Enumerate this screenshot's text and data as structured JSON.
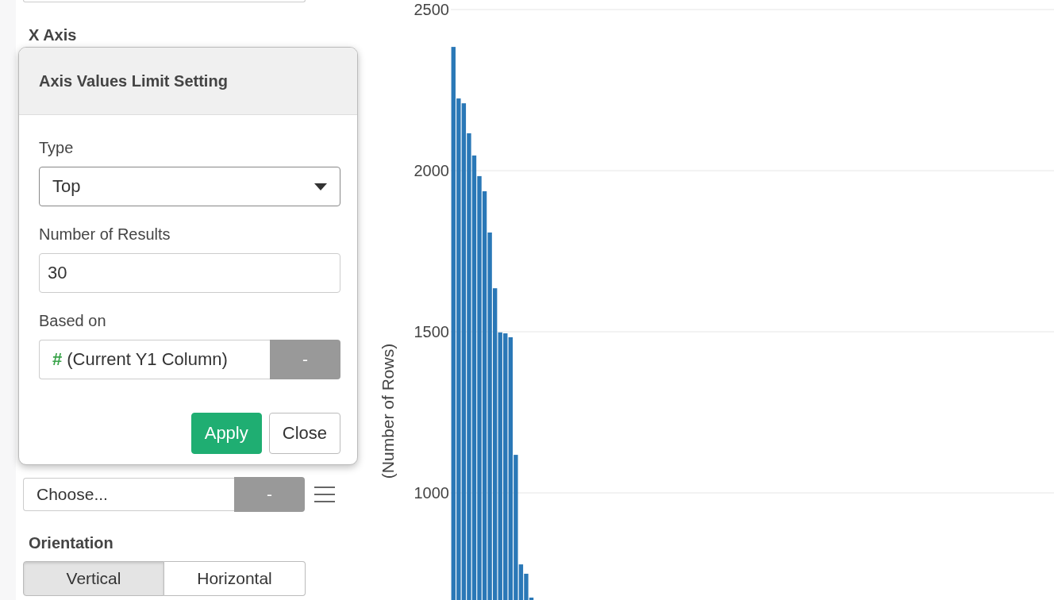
{
  "sidebar": {
    "x_axis_label": "X Axis",
    "axis_select": {
      "value": "Choose...",
      "button": "-"
    },
    "orientation": {
      "label": "Orientation",
      "options": [
        {
          "label": "Vertical",
          "selected": true
        },
        {
          "label": "Horizontal",
          "selected": false
        }
      ]
    }
  },
  "popover": {
    "title": "Axis Values Limit Setting",
    "fields": [
      {
        "kind": "select",
        "label": "Type",
        "value": "Top"
      },
      {
        "kind": "input",
        "label": "Number of Results",
        "value": "30"
      },
      {
        "kind": "column",
        "label": "Based on",
        "icon_text": "#",
        "value": "(Current Y1 Column)",
        "button": "-"
      }
    ],
    "buttons": [
      {
        "kind": "primary",
        "label": "Apply"
      },
      {
        "kind": "default",
        "label": "Close"
      }
    ]
  },
  "chart": {
    "chart_data": {
      "type": "bar",
      "ylabel": "(Number of Rows)",
      "ylim": [
        667.5,
        2500
      ],
      "grid": true,
      "yticks": [
        1000,
        1500,
        2000,
        2500
      ],
      "values": [
        2384,
        2224,
        2209,
        2116,
        2047,
        1983,
        1936,
        1808,
        1635,
        1498,
        1495,
        1483,
        1118,
        778,
        749,
        675,
        null,
        null,
        null,
        null,
        null,
        null,
        null,
        null,
        null,
        null,
        null,
        null,
        null,
        null,
        null,
        null,
        null,
        null,
        null,
        null,
        null,
        null,
        null,
        null,
        null,
        null,
        null,
        null,
        null,
        null,
        null,
        null,
        null,
        null,
        null,
        null,
        null,
        null,
        null,
        null,
        null,
        null,
        null,
        null,
        null,
        null,
        null,
        null,
        null,
        null,
        null,
        null,
        null,
        null,
        null,
        null,
        null,
        null,
        null,
        null,
        null,
        null,
        null,
        null,
        null,
        null,
        null,
        null,
        null,
        null,
        null,
        null,
        null,
        null,
        null,
        null,
        null,
        null,
        null,
        null,
        null,
        null,
        null,
        null,
        null,
        null,
        null,
        null,
        null,
        null,
        null,
        null,
        null,
        null,
        null,
        null,
        null
      ]
    }
  }
}
